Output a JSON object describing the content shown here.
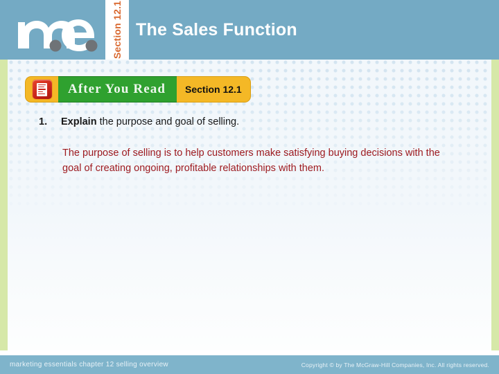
{
  "header": {
    "logo_alt": "m.e.",
    "section_tab": "Section 12.1",
    "title": "The Sales Function",
    "bg_color": "#74aac4",
    "title_color": "#ffffff",
    "section_tab_color": "#d9682f"
  },
  "banner": {
    "icon": "document-icon",
    "label": "After You Read",
    "section": "Section 12.1",
    "label_bg": "#2fa12f",
    "section_bg": "#f4b826",
    "icon_bg": "#c8241a"
  },
  "body": {
    "question_number": "1.",
    "question_bold": "Explain",
    "question_rest": " the purpose and goal of selling.",
    "answer": "The purpose of selling is to help customers make satisfying buying decisions with the goal of creating ongoing, profitable relationships with them.",
    "answer_color": "#9e1b20"
  },
  "footer": {
    "left": "marketing essentials  chapter 12  selling overview",
    "right": "Copyright © by The McGraw-Hill Companies, Inc. All rights reserved.",
    "bg_color": "#7fb4cb"
  },
  "decor": {
    "edge_strip_color": "#d6e8a8",
    "content_bg_color": "#f2f7fb"
  }
}
